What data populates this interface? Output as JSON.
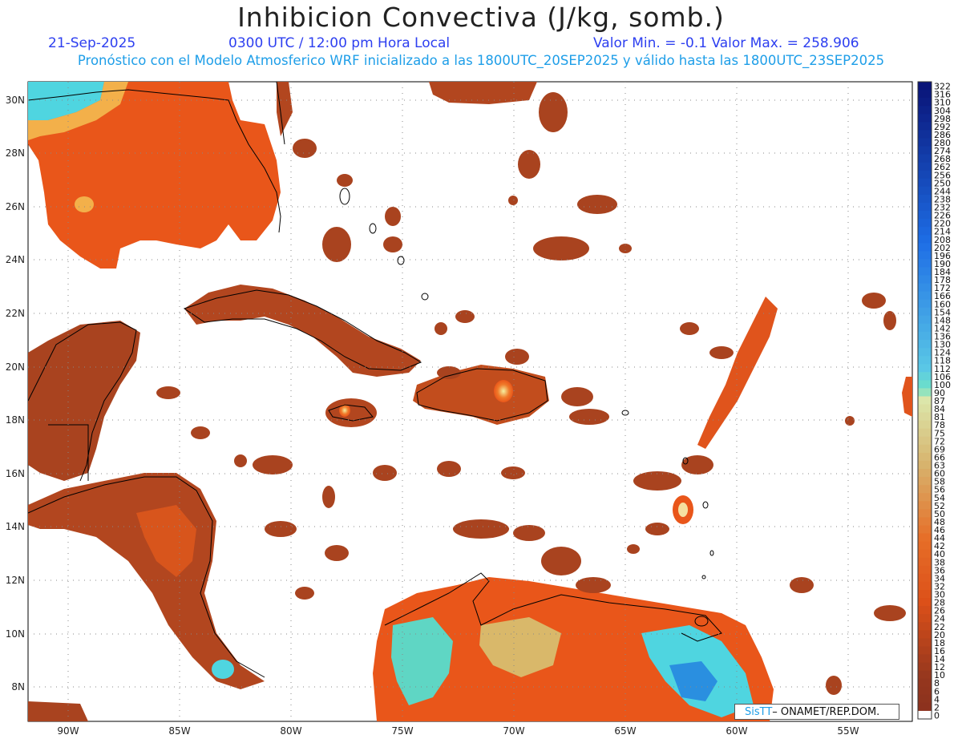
{
  "header": {
    "title": "Inhibicion Convectiva (J/kg, somb.)",
    "date": "21-Sep-2025",
    "time": "0300 UTC / 12:00 pm Hora Local",
    "minmax": "Valor Min. = -0.1  Valor Max. = 258.906",
    "subtitle": "Pronóstico con el Modelo Atmosferico WRF inicializado a las 1800UTC_20SEP2025 y válido hasta las  1800UTC_23SEP2025"
  },
  "axes": {
    "lon_ticks": [
      "90W",
      "85W",
      "80W",
      "75W",
      "70W",
      "65W",
      "60W",
      "55W"
    ],
    "lat_ticks": [
      "30N",
      "28N",
      "26N",
      "24N",
      "22N",
      "20N",
      "18N",
      "16N",
      "14N",
      "12N",
      "10N",
      "8N"
    ]
  },
  "colorbar": {
    "labels": [
      "322",
      "316",
      "310",
      "304",
      "298",
      "292",
      "286",
      "280",
      "274",
      "268",
      "262",
      "256",
      "250",
      "244",
      "238",
      "232",
      "226",
      "220",
      "214",
      "208",
      "202",
      "196",
      "190",
      "184",
      "178",
      "172",
      "166",
      "160",
      "154",
      "148",
      "142",
      "136",
      "130",
      "124",
      "118",
      "112",
      "106",
      "100",
      "90",
      "87",
      "84",
      "81",
      "78",
      "75",
      "72",
      "69",
      "66",
      "63",
      "60",
      "58",
      "56",
      "54",
      "52",
      "50",
      "48",
      "46",
      "44",
      "42",
      "40",
      "38",
      "36",
      "34",
      "32",
      "30",
      "28",
      "26",
      "24",
      "22",
      "20",
      "18",
      "16",
      "14",
      "12",
      "10",
      "8",
      "6",
      "4",
      "2",
      "0"
    ]
  },
  "credit": {
    "brand": "SisTT",
    "org": " ONAMET/REP.DOM."
  },
  "colors": {
    "cin_low": "#8e3a1e",
    "cin_mid": "#e9561a",
    "cin_high": "#4fd5e0",
    "land_outline": "#000000",
    "header_blue": "#2d3ff0",
    "subtitle_cyan": "#1e9ee8"
  }
}
